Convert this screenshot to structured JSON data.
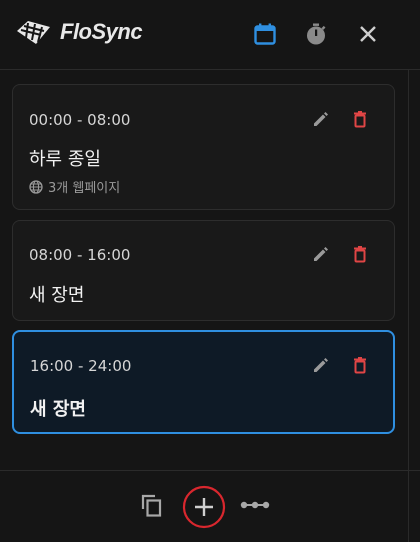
{
  "app": {
    "name": "FloSync"
  },
  "colors": {
    "accent": "#2f8fe0",
    "delete": "#e04545",
    "add_ring": "#d9272e"
  },
  "icons": {
    "header": [
      "calendar-icon",
      "timer-icon",
      "close-icon"
    ],
    "card_actions": [
      "edit-icon",
      "delete-icon"
    ],
    "footer": [
      "copy-icon",
      "add-icon",
      "more-icon"
    ]
  },
  "schedules": [
    {
      "time": "00:00 - 08:00",
      "title": "하루 종일",
      "subtitle": "3개 웹페이지"
    },
    {
      "time": "08:00 - 16:00",
      "title": "새 장면"
    },
    {
      "time": "16:00 - 24:00",
      "title": "새 장면",
      "active": true
    }
  ]
}
